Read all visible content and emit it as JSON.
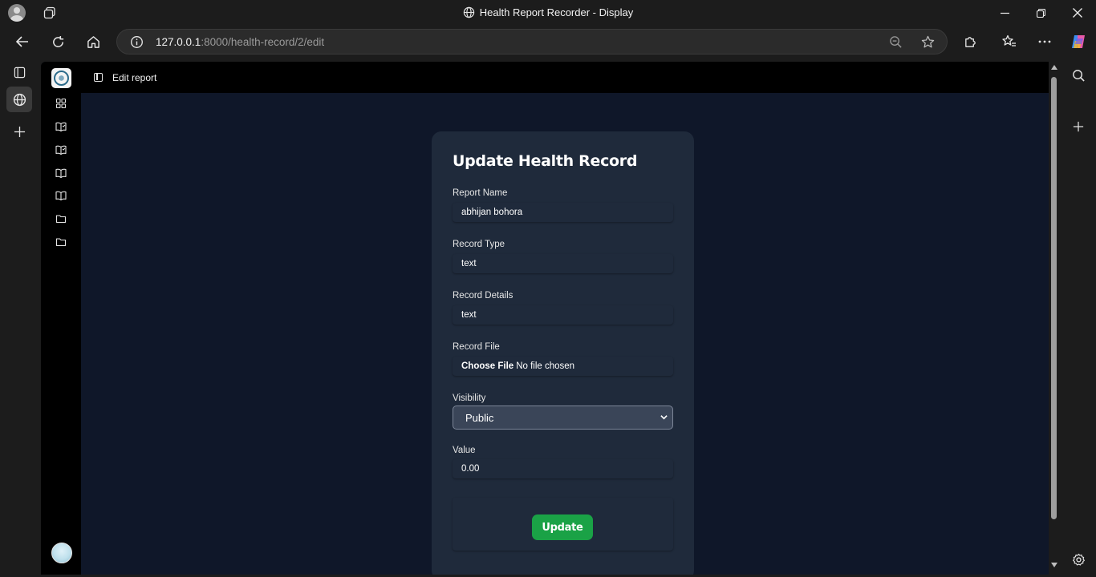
{
  "browser": {
    "window_title": "Health Report Recorder - Display",
    "url_host": "127.0.0.1",
    "url_path": ":8000/health-record/2/edit"
  },
  "app": {
    "header_title": "Edit report",
    "sidebar_icons": [
      "grid-icon",
      "book-open-icon",
      "book-open-icon",
      "book-icon",
      "book-icon",
      "folder-icon",
      "folder-icon"
    ]
  },
  "form": {
    "title": "Update Health Record",
    "fields": [
      {
        "label": "Report Name",
        "value": "abhijan bohora"
      },
      {
        "label": "Record Type",
        "value": "text"
      },
      {
        "label": "Record Details",
        "value": "text"
      },
      {
        "label": "Record File",
        "button": "Choose File",
        "status": "No file chosen"
      },
      {
        "label": "Visibility",
        "selected": "Public"
      },
      {
        "label": "Value",
        "value": "0.00"
      }
    ],
    "submit_label": "Update"
  },
  "colors": {
    "page_bg": "#0f1729",
    "card_bg": "#1f2a3b",
    "accent_green": "#1aa246"
  }
}
